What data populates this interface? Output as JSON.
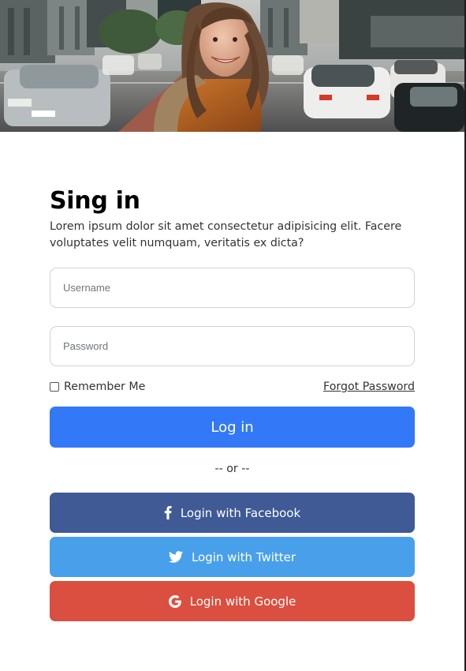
{
  "hero": {
    "image": "city-street-woman-photo"
  },
  "form": {
    "title": "Sing in",
    "subtitle": "Lorem ipsum dolor sit amet consectetur adipisicing elit. Facere voluptates velit numquam, veritatis ex dicta?",
    "username_placeholder": "Username",
    "password_placeholder": "Password",
    "remember_label": "Remember Me",
    "forgot_label": "Forgot Password",
    "login_label": "Log in",
    "or_label": "-- or --"
  },
  "social": {
    "facebook_label": "Login with Facebook",
    "twitter_label": "Login with Twitter",
    "google_label": "Login with Google"
  },
  "icons": {
    "facebook": "facebook-icon",
    "twitter": "twitter-icon",
    "google": "google-icon"
  },
  "colors": {
    "login": "#3378f6",
    "facebook": "#3f5a95",
    "twitter": "#48a0eb",
    "google": "#da4f3f"
  }
}
